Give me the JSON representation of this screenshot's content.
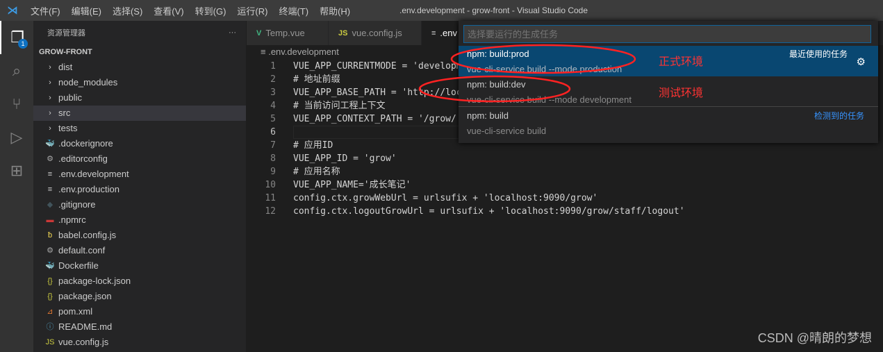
{
  "titlebar": {
    "menu": [
      "文件(F)",
      "编辑(E)",
      "选择(S)",
      "查看(V)",
      "转到(G)",
      "运行(R)",
      "终端(T)",
      "帮助(H)"
    ],
    "title": ".env.development - grow-front - Visual Studio Code"
  },
  "activity": {
    "badge": "1"
  },
  "sidebar": {
    "header": "资源管理器",
    "more": "···",
    "project": "GROW-FRONT",
    "items": [
      {
        "label": "dist",
        "icon": "›",
        "color": "#ccc"
      },
      {
        "label": "node_modules",
        "icon": "›",
        "color": "#ccc"
      },
      {
        "label": "public",
        "icon": "›",
        "color": "#ccc"
      },
      {
        "label": "src",
        "icon": "›",
        "color": "#ccc"
      },
      {
        "label": "tests",
        "icon": "›",
        "color": "#ccc"
      },
      {
        "label": ".dockerignore",
        "icon": "🐳",
        "color": "#4aa0d8"
      },
      {
        "label": ".editorconfig",
        "icon": "⚙",
        "color": "#aaa"
      },
      {
        "label": ".env.development",
        "icon": "≡",
        "color": "#ccc"
      },
      {
        "label": ".env.production",
        "icon": "≡",
        "color": "#ccc"
      },
      {
        "label": ".gitignore",
        "icon": "◆",
        "color": "#41535b"
      },
      {
        "label": ".npmrc",
        "icon": "▬",
        "color": "#cb3837"
      },
      {
        "label": "babel.config.js",
        "icon": "ƀ",
        "color": "#f5da55"
      },
      {
        "label": "default.conf",
        "icon": "⚙",
        "color": "#aaa"
      },
      {
        "label": "Dockerfile",
        "icon": "🐳",
        "color": "#4aa0d8"
      },
      {
        "label": "package-lock.json",
        "icon": "{}",
        "color": "#cbcb41"
      },
      {
        "label": "package.json",
        "icon": "{}",
        "color": "#cbcb41"
      },
      {
        "label": "pom.xml",
        "icon": "⊿",
        "color": "#e37933"
      },
      {
        "label": "README.md",
        "icon": "ⓘ",
        "color": "#519aba"
      },
      {
        "label": "vue.config.js",
        "icon": "JS",
        "color": "#cbcb41"
      }
    ]
  },
  "tabs": [
    {
      "label": "Temp.vue",
      "icon": "V",
      "color": "#41b883"
    },
    {
      "label": "vue.config.js",
      "icon": "JS",
      "color": "#cbcb41"
    },
    {
      "label": ".env",
      "icon": "≡",
      "color": "#ccc"
    }
  ],
  "breadcrumb": ".env.development",
  "code": [
    "VUE_APP_CURRENTMODE = 'developm",
    "# 地址前缀",
    "VUE_APP_BASE_PATH = 'http://loc",
    "# 当前访问工程上下文",
    "VUE_APP_CONTEXT_PATH = '/grow/'",
    "",
    "# 应用ID",
    "VUE_APP_ID = 'grow'",
    "# 应用名称",
    "VUE_APP_NAME='成长笔记'",
    "config.ctx.growWebUrl = urlsufix + 'localhost:9090/grow'",
    "config.ctx.logoutGrowUrl = urlsufix + 'localhost:9090/grow/staff/logout'"
  ],
  "quickpick": {
    "placeholder": "选择要运行的生成任务",
    "items": [
      {
        "label": "npm: build:prod",
        "detail": "vue-cli-service build --mode production",
        "group": "最近使用的任务"
      },
      {
        "label": "npm: build:dev",
        "detail": "vue-cli-service build --mode development",
        "group": ""
      },
      {
        "label": "npm: build",
        "detail": "vue-cli-service build",
        "group": "检测到的任务"
      }
    ]
  },
  "annotations": {
    "prod": "正式环境",
    "dev": "测试环境"
  },
  "watermark": "CSDN @晴朗的梦想"
}
